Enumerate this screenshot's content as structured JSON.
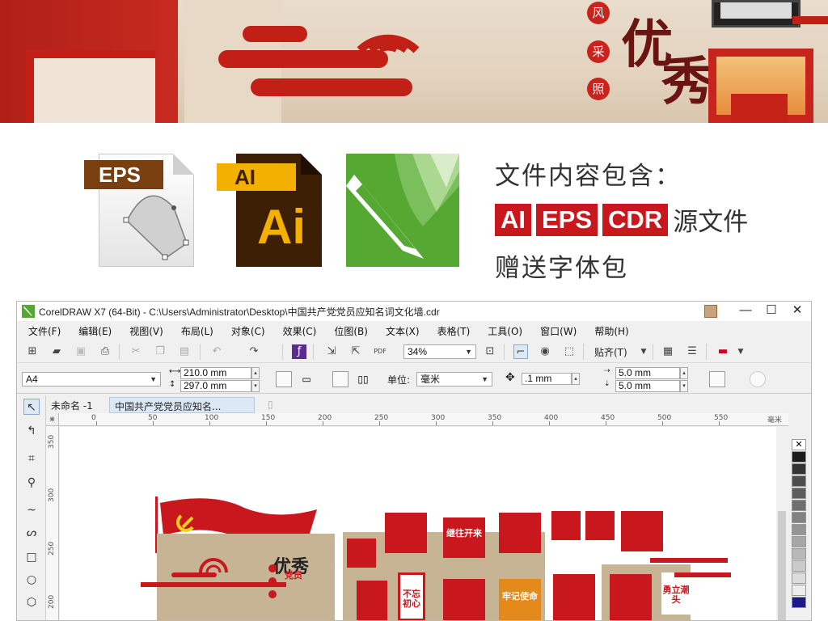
{
  "banner": {
    "wall_chars": [
      "风",
      "采",
      "照"
    ],
    "big_chars": [
      "优",
      "秀"
    ]
  },
  "formats_panel": {
    "eps_tag": "EPS",
    "ai_tag": "AI",
    "ai_big": "Ai",
    "title": "文件内容包含：",
    "formats": [
      "AI",
      "EPS",
      "CDR"
    ],
    "formats_suffix": "源文件",
    "bonus": "赠送字体包"
  },
  "window": {
    "title": "CorelDRAW X7 (64-Bit) - C:\\Users\\Administrator\\Desktop\\中国共产党党员应知名词文化墙.cdr",
    "controls": {
      "minimize": "—",
      "maximize": "☐",
      "close": "✕"
    }
  },
  "menu": [
    "文件(F)",
    "编辑(E)",
    "视图(V)",
    "布局(L)",
    "对象(C)",
    "效果(C)",
    "位图(B)",
    "文本(X)",
    "表格(T)",
    "工具(O)",
    "窗口(W)",
    "帮助(H)"
  ],
  "toolbar": {
    "zoom": "34%",
    "snap_label": "贴齐(T)",
    "icons": [
      "new-icon",
      "open-icon",
      "save-icon",
      "print-icon",
      "cut-icon",
      "copy-icon",
      "paste-icon",
      "undo-icon",
      "redo-icon",
      "search-content-icon",
      "import-icon",
      "export-icon",
      "publish-pdf-icon",
      "zoom-fit-icon",
      "full-screen-icon",
      "rulers-icon",
      "guidelines-icon",
      "options-icon",
      "launch-icon"
    ]
  },
  "propbar": {
    "page_size": "A4",
    "width": "210.0 mm",
    "height": "297.0 mm",
    "units_label": "单位:",
    "units": "毫米",
    "nudge": ".1 mm",
    "dup_x": "5.0 mm",
    "dup_y": "5.0 mm"
  },
  "doc_tabs": [
    "未命名 -1",
    "中国共产党党员应知名..."
  ],
  "ruler": {
    "h_labels": [
      "0",
      "50",
      "100",
      "150",
      "200",
      "250",
      "300",
      "350",
      "400",
      "450",
      "500",
      "550"
    ],
    "h_unit": "毫米",
    "v_labels": [
      "350",
      "300",
      "250",
      "200"
    ]
  },
  "palette": [
    "#ffffff",
    "#1a1a1a",
    "#333333",
    "#4d4d4d",
    "#5e5e5e",
    "#707070",
    "#828282",
    "#949494",
    "#a6a6a6",
    "#b8b8b8",
    "#cacaca",
    "#dcdcdc",
    "#ededed",
    "#1a1a8c"
  ],
  "canvas": {
    "tiles": [
      "继往开来",
      "不忘初心",
      "牢记使命",
      "勇立潮头"
    ],
    "poster_title": "优秀",
    "poster_sub": "党员"
  }
}
